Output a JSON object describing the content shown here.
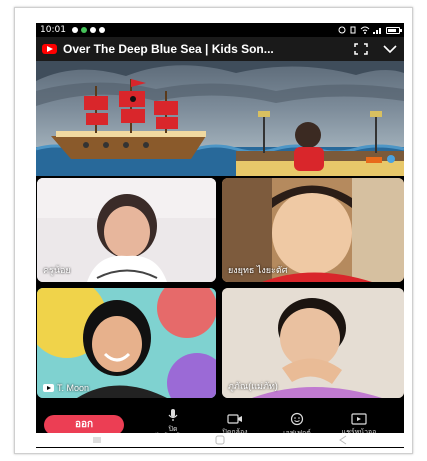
{
  "status_bar": {
    "time": "10:01",
    "icons": [
      "messenger-icon",
      "line-icon",
      "chat-icon",
      "facebook-icon"
    ],
    "right_icons": [
      "alarm-icon",
      "vibrate-icon",
      "wifi-icon",
      "signal-icon",
      "battery-icon"
    ],
    "battery_level": 0.8
  },
  "video_header": {
    "title": "Over The Deep Blue Sea | Kids Son...",
    "actions": [
      "fullscreen-icon",
      "chevron-down-icon"
    ]
  },
  "participants": [
    {
      "name": "ครูน้อย"
    },
    {
      "name": "ยงยุทธ ไงยะตัศ"
    },
    {
      "name": "T. Moon",
      "has_youtube_badge": true
    },
    {
      "name": "ภูภัณ(แม่ภัท)"
    }
  ],
  "controls": {
    "leave_label": "ออก",
    "buttons": [
      {
        "icon": "microphone-icon",
        "label": "ปิด\nไมโครโฟน"
      },
      {
        "icon": "camera-icon",
        "label": "ปิดกล้อง"
      },
      {
        "icon": "effects-icon",
        "label": "เอฟเฟกต์"
      },
      {
        "icon": "share-screen-icon",
        "label": "แชร์หน้าจอ"
      }
    ]
  },
  "colors": {
    "leave_button": "#ec3e54",
    "youtube_red": "#ff0000"
  }
}
